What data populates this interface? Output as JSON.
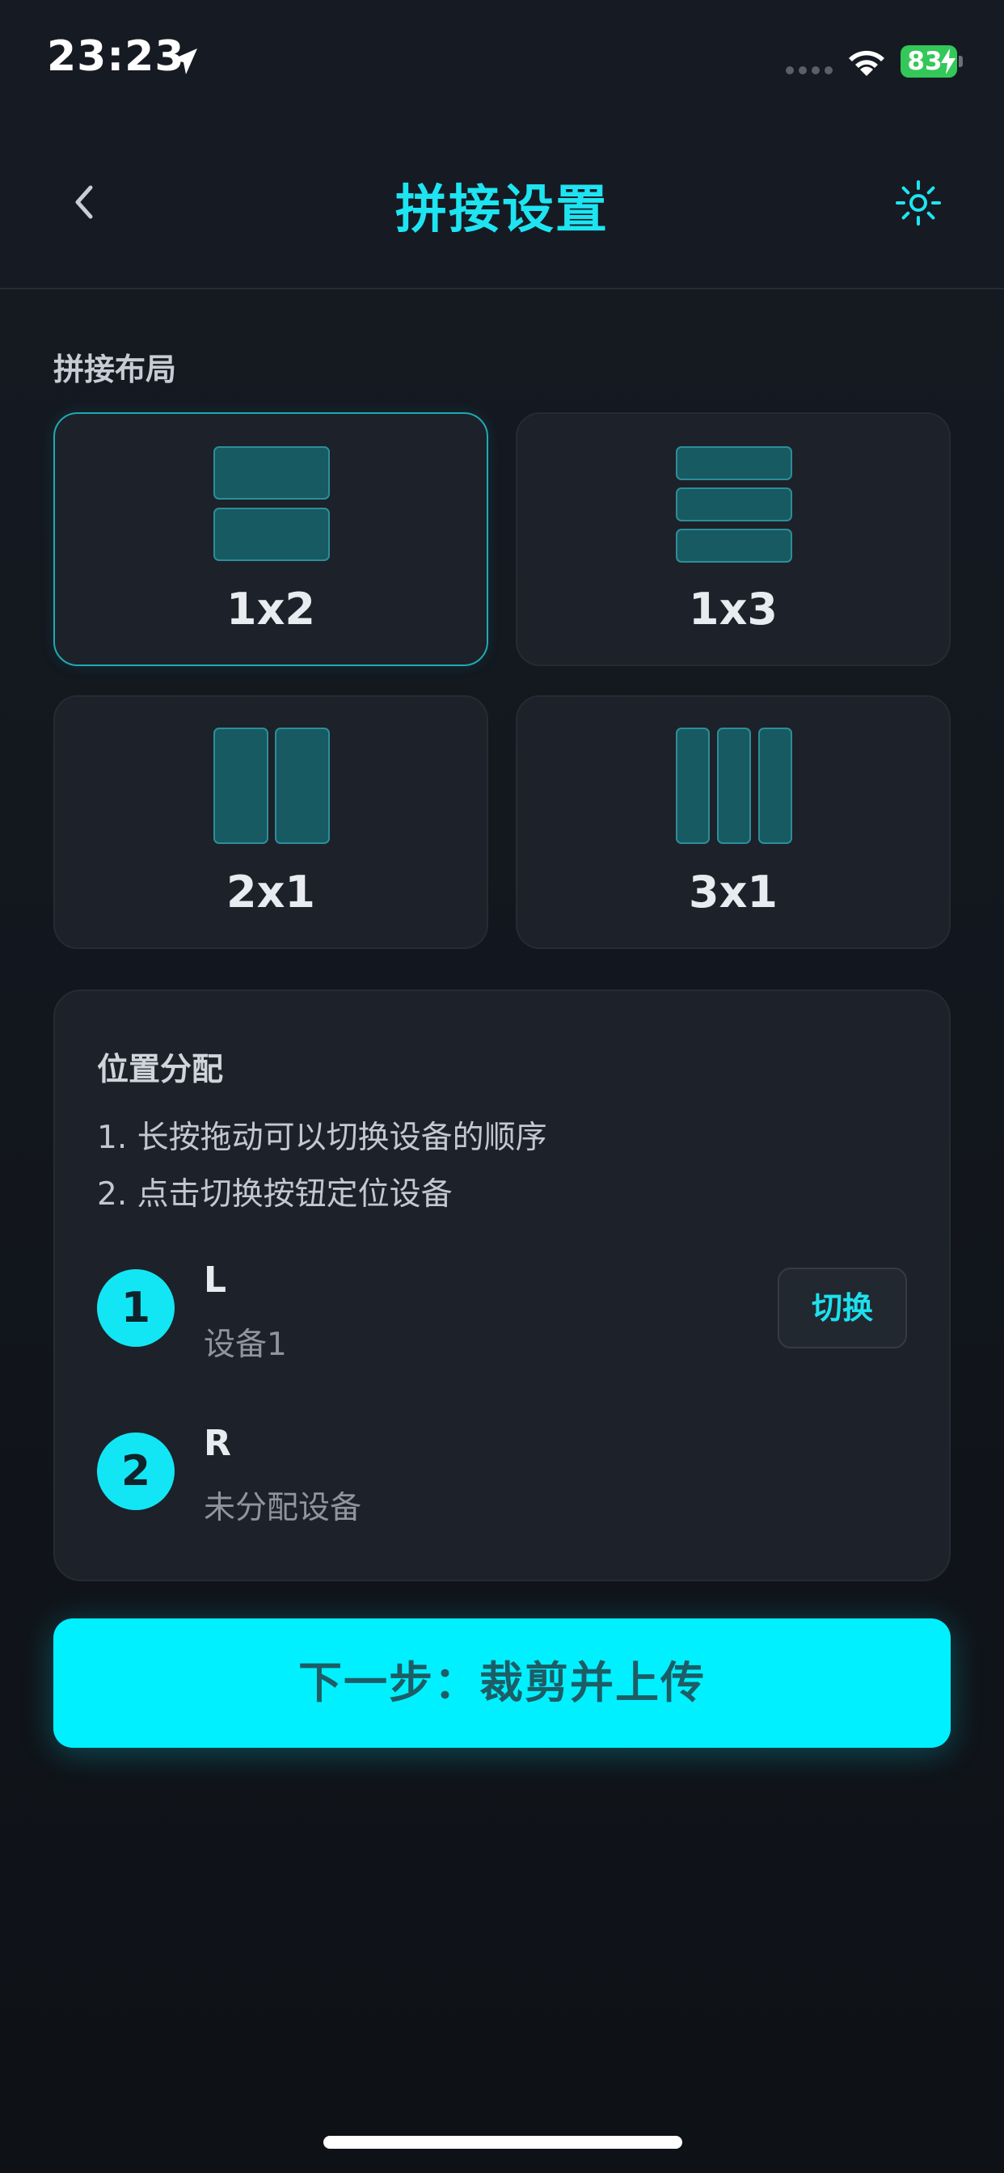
{
  "status_bar": {
    "time": "23:23",
    "battery": "83"
  },
  "header": {
    "title": "拼接设置"
  },
  "layout_section": {
    "label": "拼接布局",
    "options": [
      {
        "label": "1x2",
        "selected": true
      },
      {
        "label": "1x3",
        "selected": false
      },
      {
        "label": "2x1",
        "selected": false
      },
      {
        "label": "3x1",
        "selected": false
      }
    ]
  },
  "position_section": {
    "title": "位置分配",
    "hints": [
      "1. 长按拖动可以切换设备的顺序",
      "2. 点击切换按钮定位设备"
    ],
    "slots": [
      {
        "number": "1",
        "name": "L",
        "device": "设备1"
      },
      {
        "number": "2",
        "name": "R",
        "device": "未分配设备"
      }
    ],
    "switch_label": "切换"
  },
  "next_button": {
    "label": "下一步：裁剪并上传"
  },
  "colors": {
    "accent": "#00f0ff",
    "title": "#1ee4f2",
    "background": "#14181f",
    "card": "#1d2129",
    "tile": "#175a62",
    "battery": "#34c759"
  }
}
